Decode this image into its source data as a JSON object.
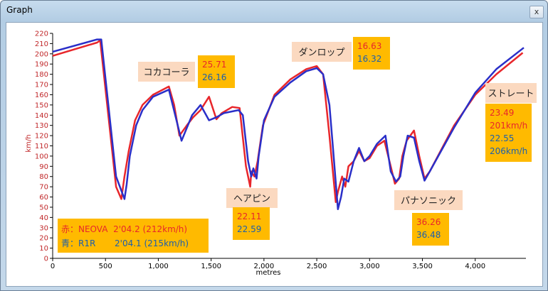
{
  "window": {
    "title": "Graph",
    "close_label": "x"
  },
  "chart_data": {
    "type": "line",
    "xlabel": "metres",
    "ylabel": "km/h",
    "xlim": [
      0,
      4480
    ],
    "ylim": [
      0,
      220
    ],
    "xticks": [
      0,
      500,
      1000,
      1500,
      2000,
      2500,
      3000,
      3500,
      4000
    ],
    "xtick_labels": [
      "0",
      "500",
      "1,000",
      "1,500",
      "2,000",
      "2,500",
      "3,000",
      "3,500",
      "4,000"
    ],
    "yticks": [
      0,
      10,
      20,
      30,
      40,
      50,
      60,
      70,
      80,
      90,
      100,
      110,
      120,
      130,
      140,
      150,
      160,
      170,
      180,
      190,
      200,
      210,
      220
    ],
    "grid": false,
    "series": [
      {
        "color": "#e8262b",
        "x": [
          0,
          420,
          450,
          600,
          650,
          680,
          720,
          780,
          850,
          950,
          1100,
          1150,
          1200,
          1270,
          1330,
          1400,
          1480,
          1550,
          1600,
          1700,
          1770,
          1830,
          1870,
          1880,
          1910,
          1940,
          1990,
          2100,
          2250,
          2400,
          2500,
          2560,
          2620,
          2680,
          2700,
          2740,
          2770,
          2800,
          2850,
          2900,
          2950,
          3000,
          3070,
          3140,
          3200,
          3240,
          3280,
          3310,
          3350,
          3420,
          3470,
          3520,
          3570,
          3800,
          4000,
          4200,
          4450
        ],
        "y": [
          198,
          211,
          213,
          70,
          58,
          80,
          105,
          135,
          150,
          160,
          168,
          150,
          120,
          130,
          138,
          145,
          158,
          136,
          142,
          148,
          147,
          90,
          70,
          85,
          80,
          95,
          130,
          160,
          175,
          185,
          188,
          180,
          120,
          55,
          65,
          80,
          70,
          90,
          95,
          105,
          95,
          98,
          110,
          115,
          90,
          73,
          78,
          100,
          115,
          125,
          100,
          78,
          85,
          130,
          160,
          180,
          201
        ]
      },
      {
        "color": "#2a2fc8",
        "x": [
          0,
          420,
          460,
          600,
          680,
          700,
          730,
          790,
          850,
          950,
          1100,
          1160,
          1220,
          1260,
          1320,
          1400,
          1480,
          1550,
          1620,
          1760,
          1800,
          1850,
          1880,
          1900,
          1930,
          1950,
          2000,
          2100,
          2250,
          2400,
          2500,
          2560,
          2620,
          2660,
          2700,
          2730,
          2760,
          2800,
          2850,
          2900,
          2950,
          3000,
          3070,
          3150,
          3200,
          3250,
          3290,
          3320,
          3360,
          3420,
          3470,
          3520,
          3570,
          3800,
          4000,
          4200,
          4460
        ],
        "y": [
          202,
          214,
          214,
          80,
          58,
          72,
          100,
          130,
          145,
          158,
          165,
          140,
          115,
          125,
          140,
          150,
          135,
          138,
          142,
          145,
          140,
          95,
          80,
          88,
          78,
          100,
          135,
          158,
          172,
          183,
          186,
          180,
          150,
          100,
          48,
          60,
          78,
          75,
          95,
          108,
          95,
          100,
          112,
          120,
          85,
          75,
          80,
          100,
          120,
          118,
          95,
          76,
          85,
          128,
          162,
          185,
          206
        ]
      }
    ]
  },
  "annotations": [
    {
      "name": "コカコーラ",
      "lines": [
        {
          "text": "25.71",
          "color": "#e8262b"
        },
        {
          "text": "26.16",
          "color": "#1a5fae"
        }
      ]
    },
    {
      "name": "ダンロップ",
      "lines": [
        {
          "text": "16.63",
          "color": "#e8262b"
        },
        {
          "text": "16.32",
          "color": "#1a5fae"
        }
      ]
    },
    {
      "name": "ヘアピン",
      "lines": [
        {
          "text": "22.11",
          "color": "#e8262b"
        },
        {
          "text": "22.59",
          "color": "#1a5fae"
        }
      ]
    },
    {
      "name": "パナソニック",
      "lines": [
        {
          "text": "36.26",
          "color": "#e8262b"
        },
        {
          "text": "36.48",
          "color": "#1a5fae"
        }
      ]
    },
    {
      "name": "ストレート",
      "lines": [
        {
          "text": "23.49",
          "color": "#e8262b"
        },
        {
          "text": "201km/h",
          "color": "#e8262b"
        },
        {
          "text": "22.55",
          "color": "#1a5fae"
        },
        {
          "text": "206km/h",
          "color": "#1a5fae"
        }
      ]
    }
  ],
  "legend": [
    {
      "text": "赤：NEOVA  2'04.2 (212km/h)",
      "color": "#e8262b"
    },
    {
      "text": "青：R1R       2'04.1 (215km/h)",
      "color": "#1a5fae"
    }
  ],
  "colors": {
    "label_bg": "#fbd9c0",
    "value_bg": "#ffba00",
    "axis": "#000000",
    "ylabel_color": "#c0282a"
  }
}
